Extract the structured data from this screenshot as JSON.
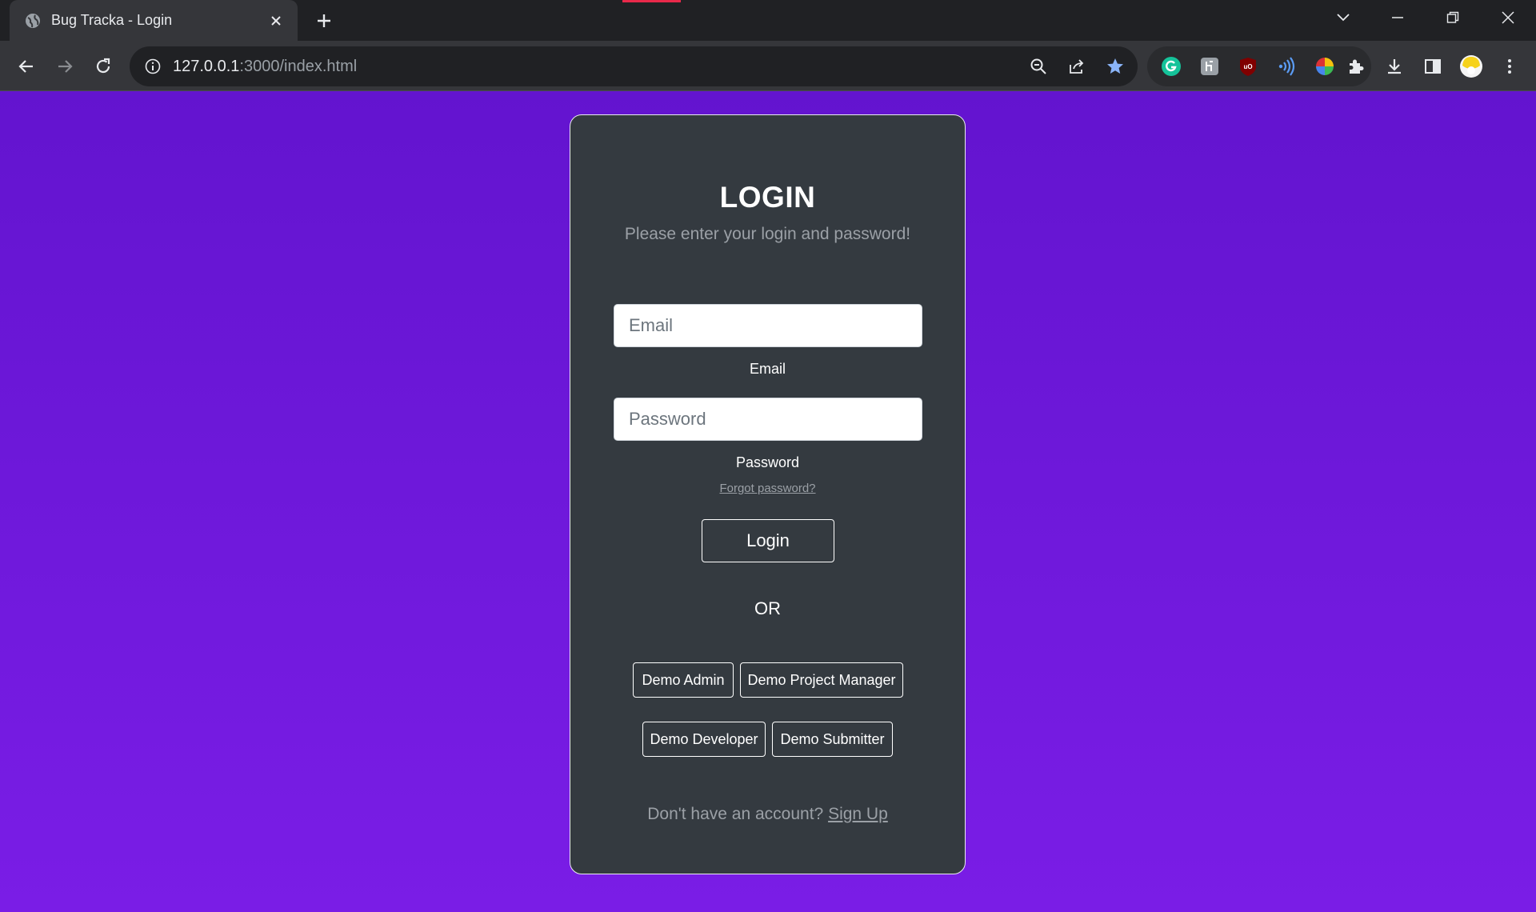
{
  "browser": {
    "tab_title": "Bug Tracka - Login",
    "url_host": "127.0.0.1",
    "url_rest": ":3000/index.html"
  },
  "login": {
    "heading": "LOGIN",
    "subtitle": "Please enter your login and password!",
    "email_placeholder": "Email",
    "email_label": "Email",
    "password_placeholder": "Password",
    "password_label": "Password",
    "forgot_link": "Forgot password?",
    "login_button": "Login",
    "or_text": "OR",
    "demo_buttons": [
      "Demo Admin",
      "Demo Project Manager",
      "Demo Developer",
      "Demo Submitter"
    ],
    "signup_prompt": "Don't have an account?",
    "signup_link": "Sign Up"
  },
  "colors": {
    "background_top": "#6314cf",
    "background_bottom": "#7a1de6",
    "card": "#343a40",
    "muted_text": "#9ba0a6"
  }
}
